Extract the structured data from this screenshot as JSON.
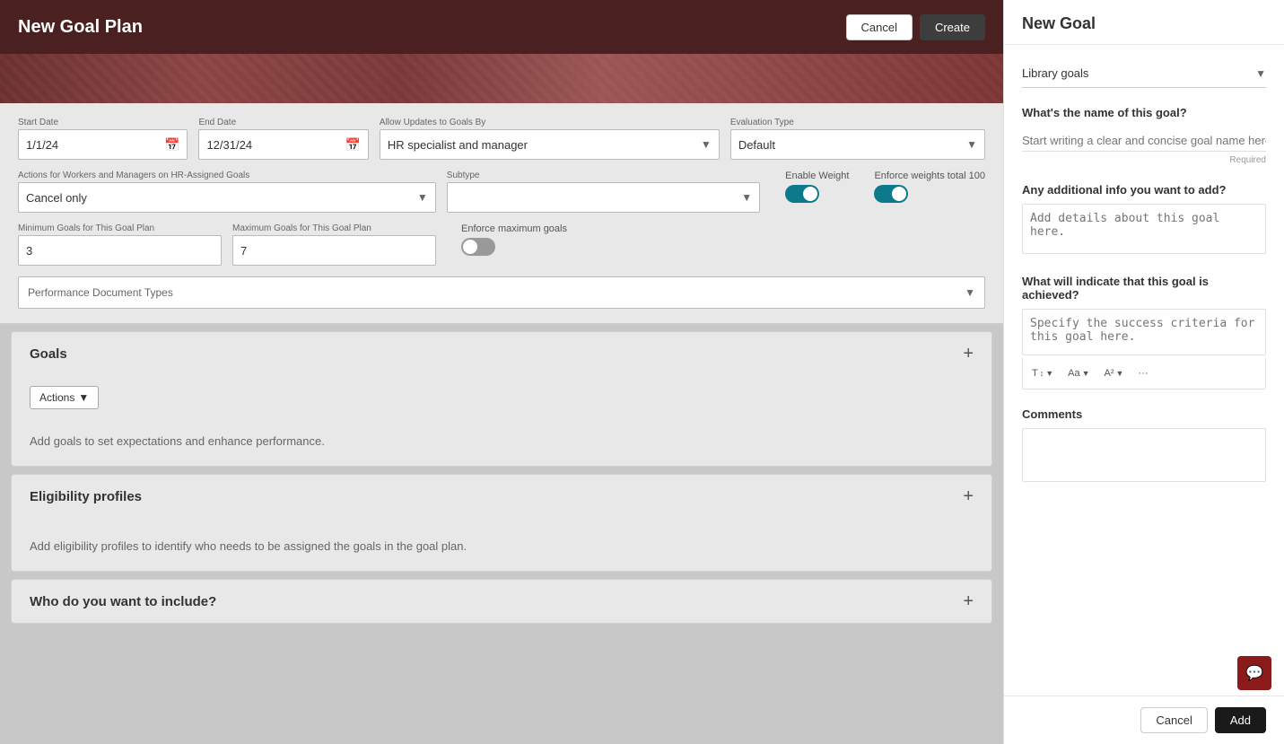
{
  "leftPanel": {
    "title": "New Goal Plan",
    "cancelBtn": "Cancel",
    "createBtn": "Create",
    "startDateLabel": "Start Date",
    "startDateValue": "1/1/24",
    "endDateLabel": "End Date",
    "endDateValue": "12/31/24",
    "allowUpdatesLabel": "Allow Updates to Goals By",
    "allowUpdatesValue": "HR specialist and manager",
    "evaluationTypeLabel": "Evaluation Type",
    "evaluationTypeValue": "Default",
    "actionsLabel": "Actions for Workers and Managers on HR-Assigned Goals",
    "actionsValue": "Cancel only",
    "subtypeLabel": "Subtype",
    "subtypePlaceholder": "",
    "enableWeightLabel": "Enable Weight",
    "enforceWeightsLabel": "Enforce weights total 100",
    "minGoalsLabel": "Minimum Goals for This Goal Plan",
    "minGoalsValue": "3",
    "maxGoalsLabel": "Maximum Goals for This Goal Plan",
    "maxGoalsValue": "7",
    "enforceMaxLabel": "Enforce maximum goals",
    "perfDocLabel": "Performance Document Types",
    "goalsSection": {
      "title": "Goals",
      "actionsBtn": "Actions",
      "emptyText": "Add goals to set expectations and enhance performance."
    },
    "eligibilitySection": {
      "title": "Eligibility profiles",
      "emptyText": "Add eligibility profiles to identify who needs to be assigned the goals in the goal plan."
    },
    "whoSection": {
      "title": "Who do you want to include?"
    }
  },
  "rightPanel": {
    "title": "New Goal",
    "libraryGoalsLabel": "Library goals",
    "libraryGoalsDropdown": "Library goals",
    "goalNameQuestion": "What's the name of this goal?",
    "goalNamePlaceholder": "Start writing a clear and concise goal name here.",
    "requiredText": "Required",
    "additionalInfoQuestion": "Any additional info you want to add?",
    "additionalInfoPlaceholder": "Add details about this goal here.",
    "achievedQuestion": "What will indicate that this goal is achieved?",
    "achievedPlaceholder": "Specify the success criteria for this goal here.",
    "commentsLabel": "Comments",
    "cancelBtn": "Cancel",
    "addBtn": "Add",
    "toolbar": {
      "format1": "T↕",
      "format2": "Aa",
      "format3": "A²",
      "more": "···"
    }
  }
}
